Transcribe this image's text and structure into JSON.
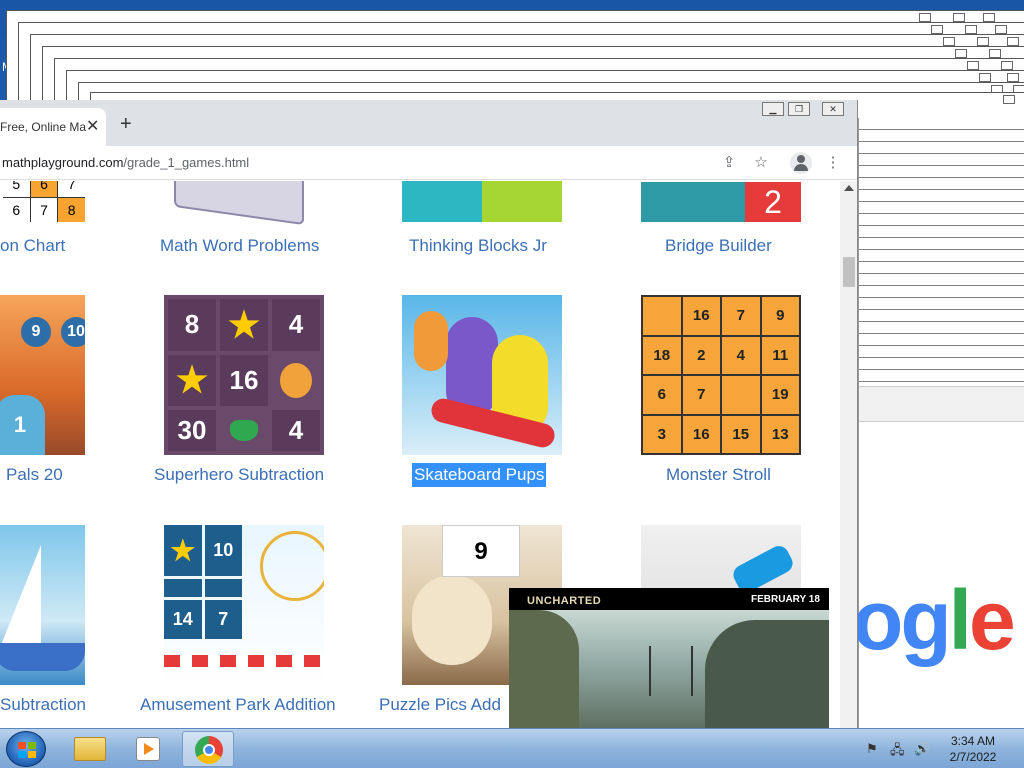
{
  "desktop": {
    "label": "M"
  },
  "browser": {
    "tab_title": "Free, Online Ma",
    "url_domain": "mathplayground.com",
    "url_path": "/grade_1_games.html",
    "new_tab_symbol": "+",
    "close_symbol": "✕",
    "window_controls": {
      "minimize": "▁",
      "restore": "❐",
      "close": "✕"
    }
  },
  "games": {
    "row1": [
      "on Chart",
      "Math Word Problems",
      "Thinking Blocks Jr",
      "Bridge Builder"
    ],
    "row2": [
      "Pals 20",
      "Superhero Subtraction",
      "Skateboard Pups",
      "Monster Stroll"
    ],
    "row3": [
      "Subtraction",
      "Amusement Park Addition",
      "Puzzle Pics Add",
      ""
    ]
  },
  "thumbs": {
    "number_chart": [
      "5",
      "6",
      "7",
      "6",
      "7",
      "8"
    ],
    "bridge_number": "2",
    "pals_numbers": [
      "9",
      "10",
      "1"
    ],
    "superhero_grid": [
      "8",
      "★",
      "4",
      "★",
      "16",
      "",
      "30",
      "",
      "4"
    ],
    "monster_grid": [
      "",
      "16",
      "7",
      "9",
      "18",
      "2",
      "4",
      "11",
      "6",
      "7",
      "",
      "19",
      "3",
      "16",
      "15",
      "13"
    ],
    "amusement_grid": [
      "★",
      "10",
      "",
      "",
      "14",
      "7"
    ],
    "puzzle_number": "9"
  },
  "video_ad": {
    "brand": "UNCHARTED",
    "date": "FEBRUARY 18"
  },
  "google_logo": {
    "part1": "o",
    "part2": "g",
    "part3": "l",
    "part4": "e"
  },
  "taskbar": {
    "time": "3:34 AM",
    "date": "2/7/2022"
  }
}
